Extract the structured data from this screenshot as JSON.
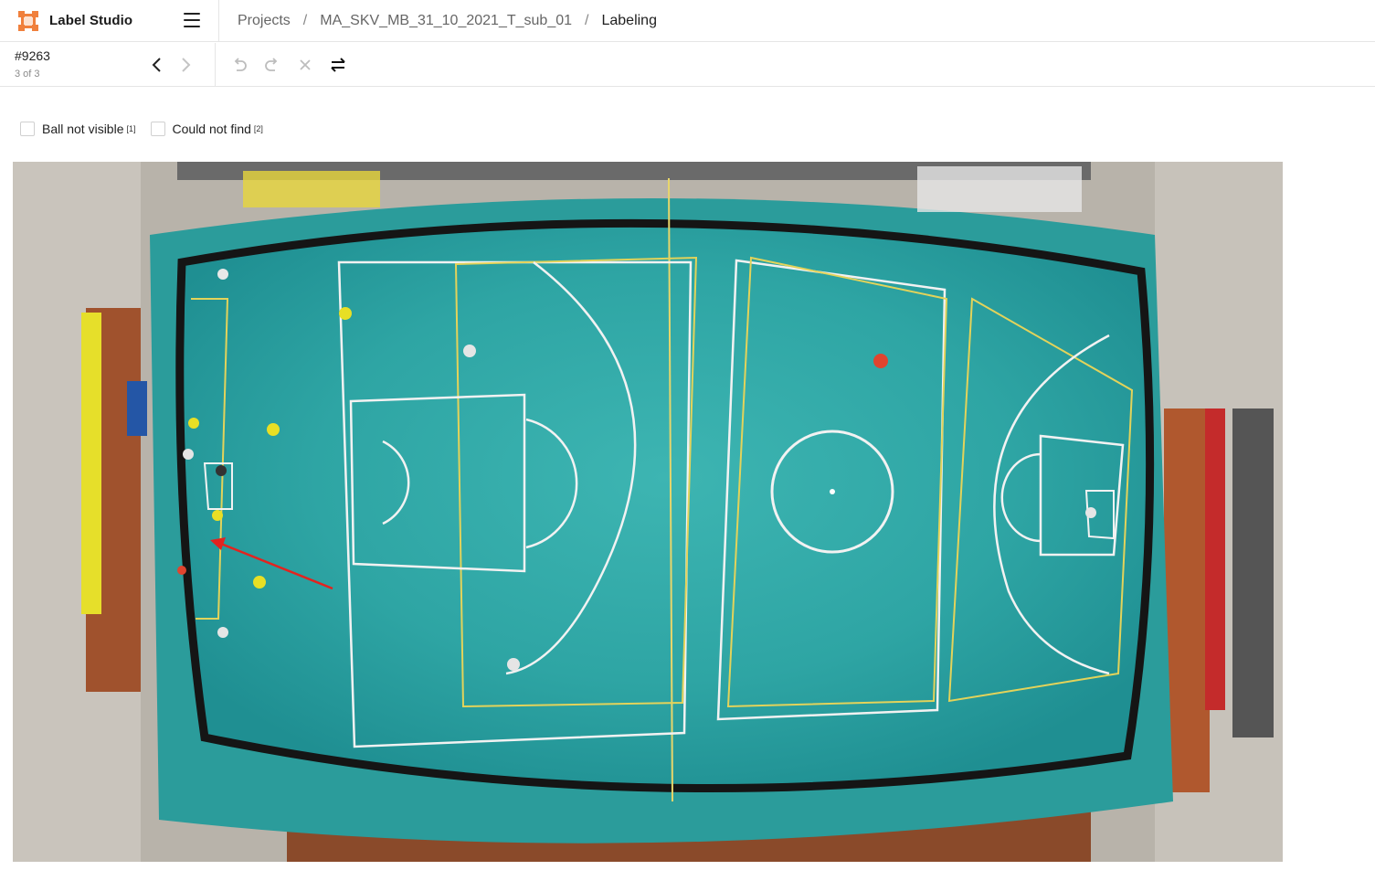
{
  "app": {
    "name": "Label Studio"
  },
  "breadcrumb": {
    "projects": "Projects",
    "project": "MA_SKV_MB_31_10_2021_T_sub_01",
    "page": "Labeling"
  },
  "task": {
    "id": "#9263",
    "counter": "3 of 3"
  },
  "choices": [
    {
      "label": "Ball not visible",
      "hotkey": "[1]",
      "checked": false
    },
    {
      "label": "Could not find",
      "hotkey": "[2]",
      "checked": false
    }
  ],
  "icons": {
    "menu": "hamburger-menu-icon",
    "prev": "chevron-left-icon",
    "next": "chevron-right-icon",
    "undo": "undo-icon",
    "redo": "redo-icon",
    "reset": "close-icon",
    "settings": "swap-arrows-icon"
  },
  "colors": {
    "accent": "#f0803c",
    "court": "#2fa3a3",
    "arrow": "#e3231f"
  }
}
